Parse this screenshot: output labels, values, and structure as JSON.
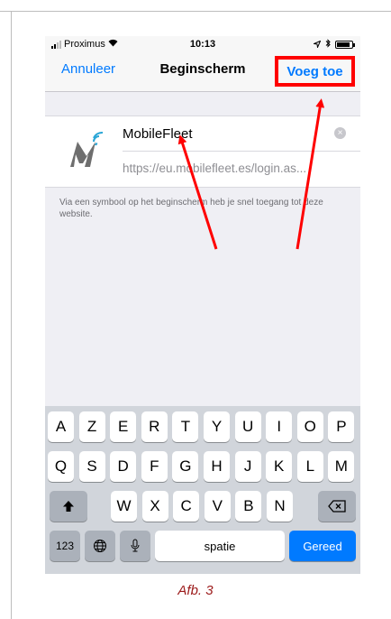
{
  "status_bar": {
    "carrier": "Proximus",
    "time": "10:13",
    "battery_level": 0.9
  },
  "nav": {
    "cancel_label": "Annuleer",
    "title": "Beginscherm",
    "add_label": "Voeg toe"
  },
  "form": {
    "name_value": "MobileFleet",
    "url": "https://eu.mobilefleet.es/login.as...",
    "hint": "Via een symbool op het beginscherm heb je snel toegang tot deze website."
  },
  "keyboard": {
    "row1": [
      "A",
      "Z",
      "E",
      "R",
      "T",
      "Y",
      "U",
      "I",
      "O",
      "P"
    ],
    "row2": [
      "Q",
      "S",
      "D",
      "F",
      "G",
      "H",
      "J",
      "K",
      "L",
      "M"
    ],
    "row3": [
      "W",
      "X",
      "C",
      "V",
      "B",
      "N"
    ],
    "numbers_label": "123",
    "space_label": "spatie",
    "done_label": "Gereed"
  },
  "caption": "Afb. 3",
  "colors": {
    "accent": "#007aff",
    "highlight": "#ff0000",
    "caption": "#9c1b1b"
  },
  "icons": [
    "wifi-icon",
    "location-icon",
    "bluetooth-icon",
    "battery-icon",
    "clear-icon",
    "shift-icon",
    "backspace-icon",
    "globe-icon",
    "microphone-icon"
  ]
}
